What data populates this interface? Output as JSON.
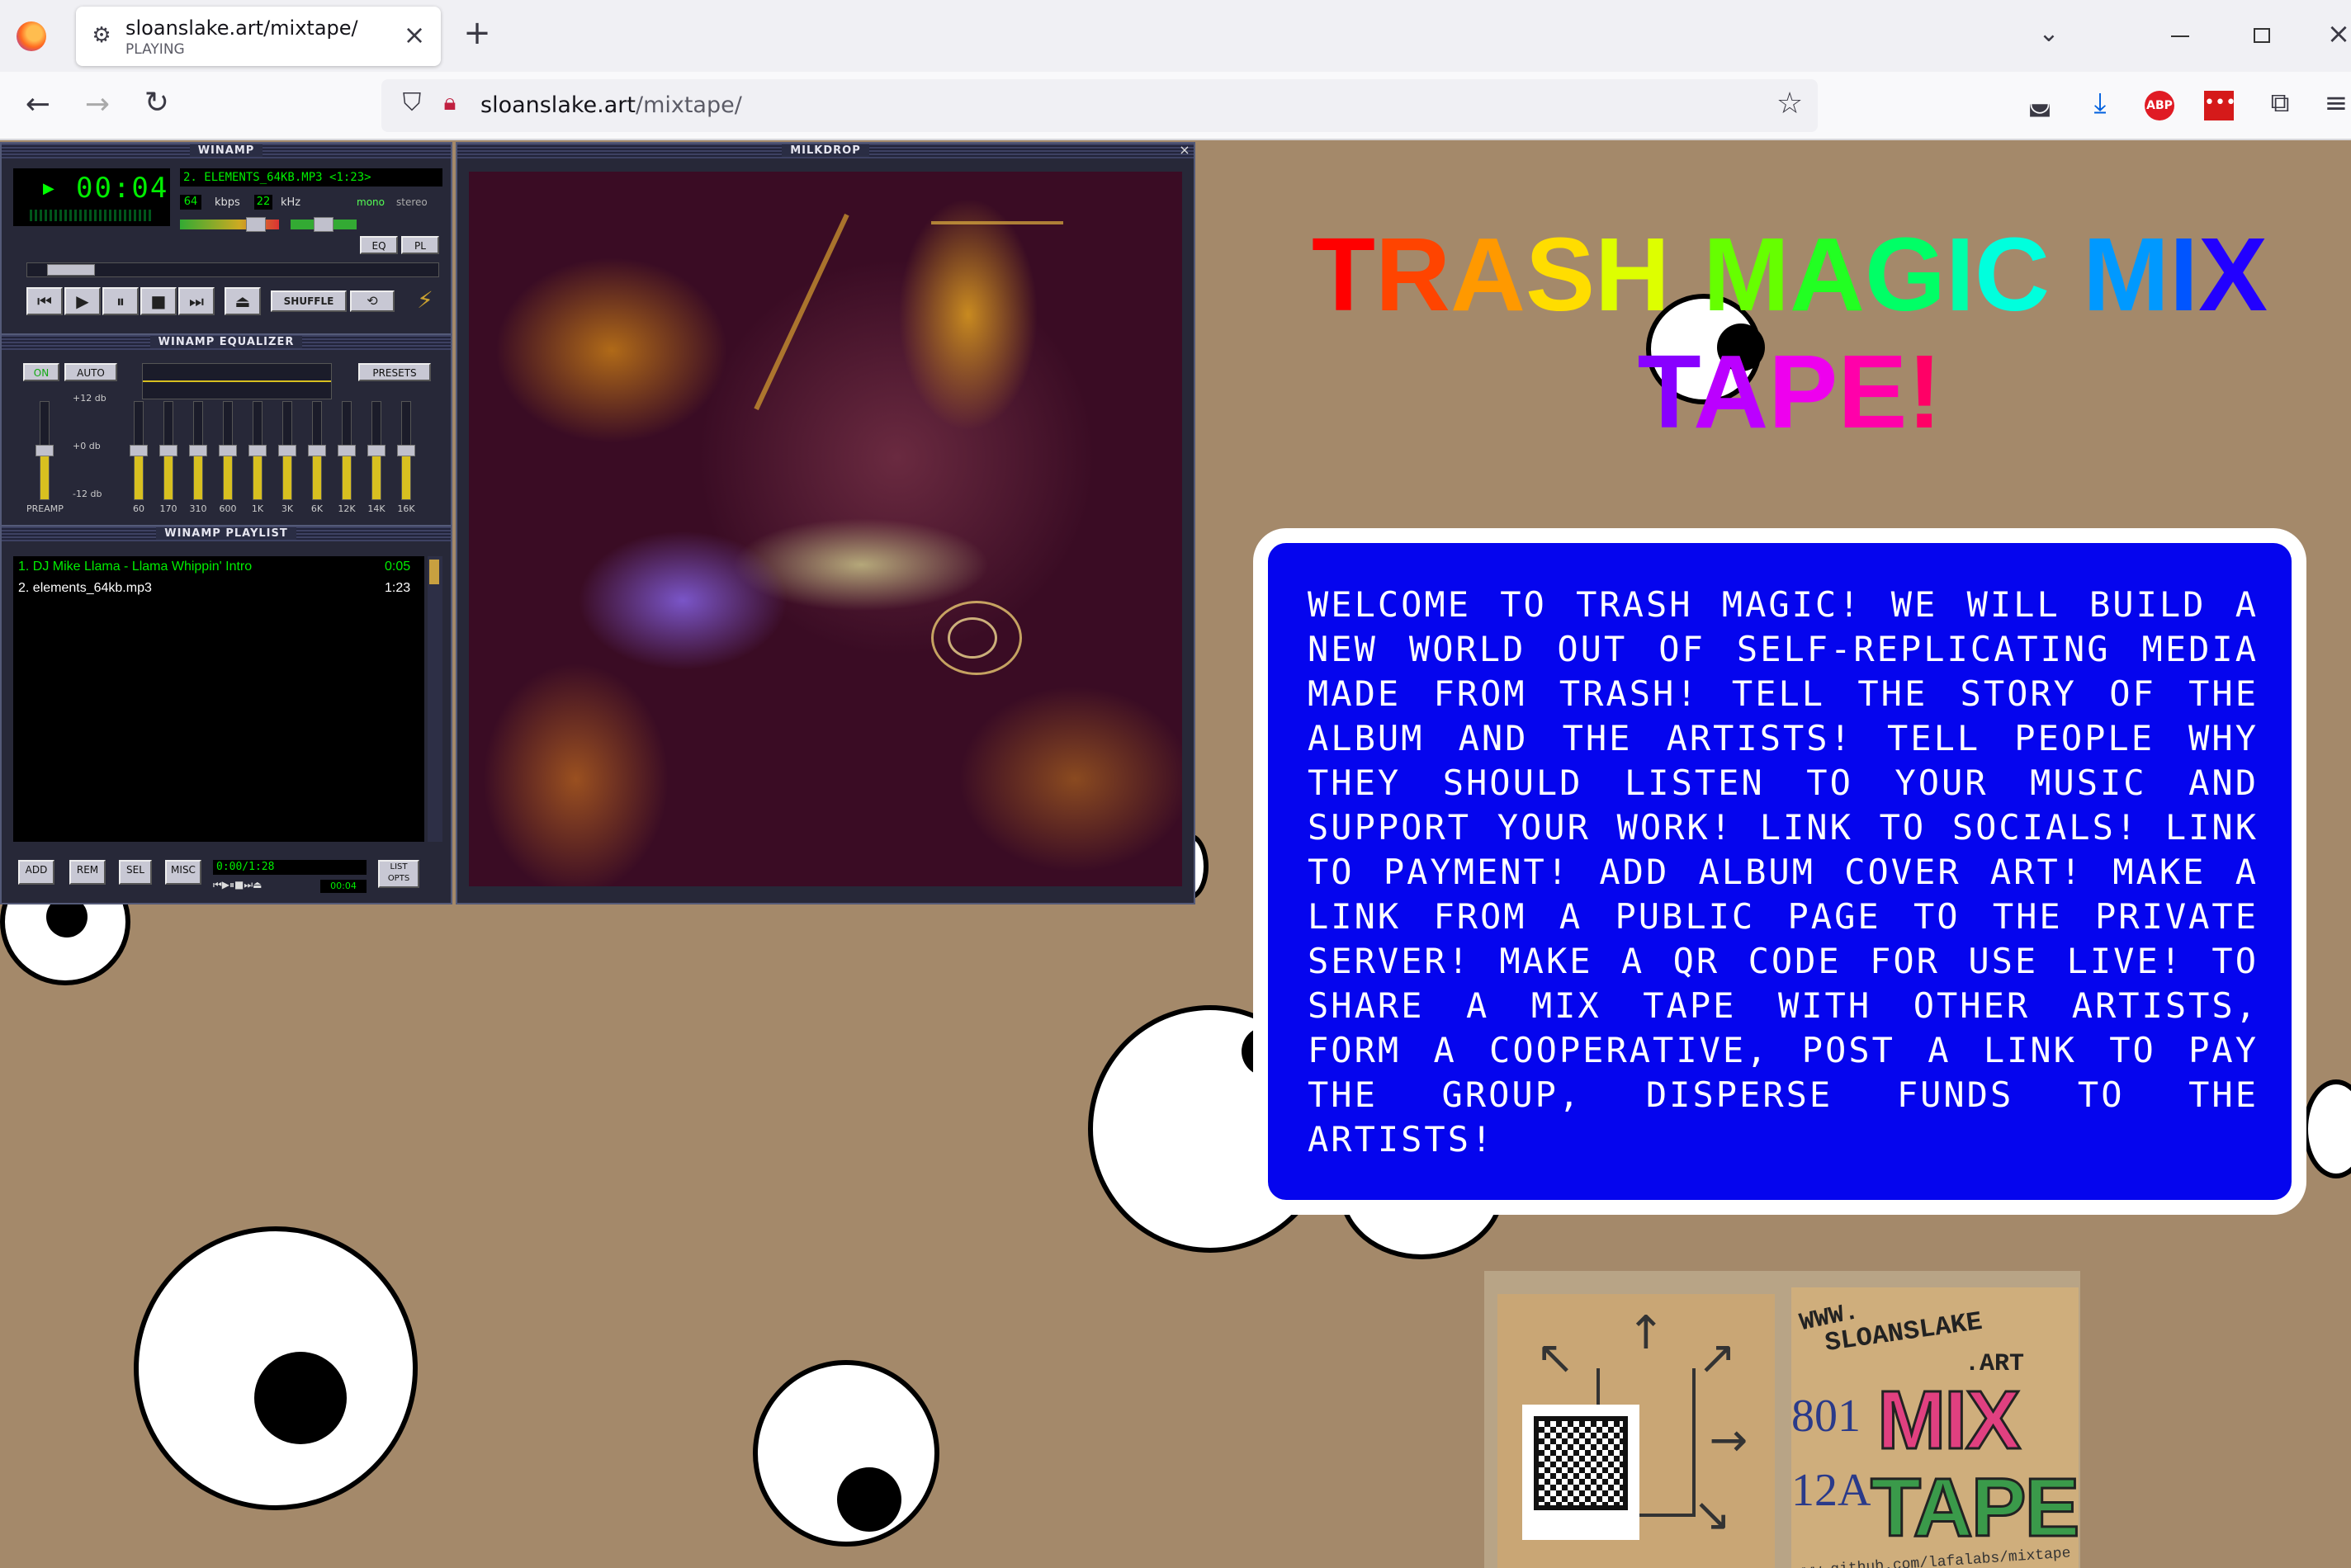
{
  "browser": {
    "tab_title": "sloanslake.art/mixtape/",
    "tab_status": "PLAYING",
    "url_domain": "sloanslake.art",
    "url_path": "/mixtape/",
    "new_tab_symbol": "+",
    "close_symbol": "×"
  },
  "winamp": {
    "title": "WINAMP",
    "time": "00:04",
    "song": "2. ELEMENTS_64KB.MP3 <1:23>",
    "kbps": "64",
    "kbps_label": "kbps",
    "khz": "22",
    "khz_label": "kHz",
    "mono": "mono",
    "stereo": "stereo",
    "shuffle": "SHUFFLE",
    "eq_btn": "EQ",
    "pl_btn": "PL",
    "equalizer_title": "WINAMP EQUALIZER",
    "on": "ON",
    "auto": "AUTO",
    "presets": "PRESETS",
    "plus12": "+12 db",
    "zero": "+0 db",
    "minus12": "-12 db",
    "preamp": "PREAMP",
    "bands": [
      "60",
      "170",
      "310",
      "600",
      "1K",
      "3K",
      "6K",
      "12K",
      "14K",
      "16K"
    ],
    "playlist_title": "WINAMP PLAYLIST",
    "playlist": [
      {
        "name": "1. DJ Mike Llama - Llama Whippin' Intro",
        "length": "0:05",
        "active": true
      },
      {
        "name": "2. elements_64kb.mp3",
        "length": "1:23",
        "active": false
      }
    ],
    "pl_add": "ADD",
    "pl_rem": "REM",
    "pl_sel": "SEL",
    "pl_misc": "MISC",
    "pl_time": "0:00/1:28",
    "pl_small_time": "00:04",
    "pl_list": "LIST OPTS",
    "milkdrop_title": "MILKDROP"
  },
  "page": {
    "title_letters": [
      {
        "ch": "T",
        "color": "#ff0000"
      },
      {
        "ch": "R",
        "color": "#ff4400"
      },
      {
        "ch": "A",
        "color": "#ff9900"
      },
      {
        "ch": "S",
        "color": "#ffdd00"
      },
      {
        "ch": "H",
        "color": "#ddff00"
      },
      {
        "ch": " ",
        "color": "#000000"
      },
      {
        "ch": "M",
        "color": "#66ff00"
      },
      {
        "ch": "A",
        "color": "#22ff22"
      },
      {
        "ch": "G",
        "color": "#00ff66"
      },
      {
        "ch": "I",
        "color": "#00ffaa"
      },
      {
        "ch": "C",
        "color": "#00ffdd"
      },
      {
        "ch": " ",
        "color": "#000000"
      },
      {
        "ch": "M",
        "color": "#0099ff"
      },
      {
        "ch": "I",
        "color": "#0055ff"
      },
      {
        "ch": "X",
        "color": "#2200ff"
      }
    ],
    "title_line2_letters": [
      {
        "ch": "T",
        "color": "#8800ff"
      },
      {
        "ch": "A",
        "color": "#bb00ff"
      },
      {
        "ch": "P",
        "color": "#ee00ee"
      },
      {
        "ch": "E",
        "color": "#ff00aa"
      },
      {
        "ch": "!",
        "color": "#ff0066"
      }
    ],
    "welcome_text": "WELCOME TO TRASH MAGIC! WE WILL BUILD A NEW WORLD OUT OF SELF-REPLICATING MEDIA MADE FROM TRASH! TELL THE STORY OF THE ALBUM AND THE ARTISTS! TELL PEOPLE WHY THEY SHOULD LISTEN TO YOUR MUSIC AND SUPPORT YOUR WORK! LINK TO SOCIALS! LINK TO PAYMENT! ADD ALBUM COVER ART! MAKE A LINK FROM A PUBLIC PAGE TO THE PRIVATE SERVER! MAKE A QR CODE FOR USE LIVE! TO SHARE A MIX TAPE WITH OTHER ARTISTS, FORM A COOPERATIVE, POST A LINK TO PAY THE GROUP, DISPERSE FUNDS TO THE ARTISTS!",
    "photo_www": "WWW.",
    "photo_domain": "SLOANSLAKE",
    "photo_art": ".ART",
    "photo_num1": "801",
    "photo_num2": "12A",
    "photo_mix": "MIX",
    "photo_tape": "TAPE",
    "photo_github": "www.github.com/lafalabs/mixtape"
  },
  "colors": {
    "page_bg": "#a4896a",
    "welcome_bg": "#0505ee",
    "winamp_green": "#00ff00"
  }
}
